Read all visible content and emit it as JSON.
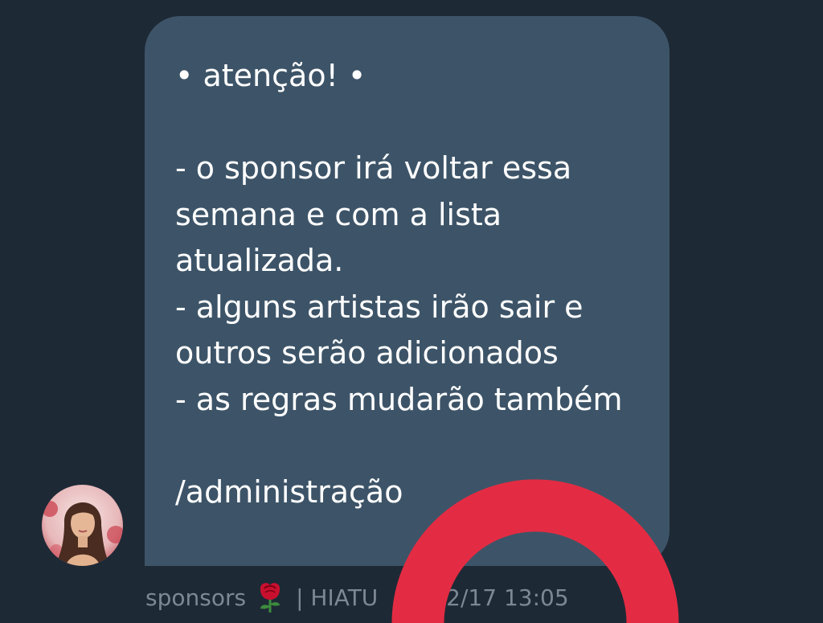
{
  "message": {
    "text": "• atenção! •\n\n- o sponsor irá voltar essa semana e com a lista atualizada.\n- alguns artistas irão sair e outros serão adicionados\n- as regras mudarão também\n\n/administração"
  },
  "meta": {
    "sender": "sponsors",
    "separator": "| HIATU",
    "timestamp": "02/12/17 13:05"
  },
  "icons": {
    "sender_emoji": "rose-icon",
    "overlay": "red-ring-overlay"
  },
  "colors": {
    "background": "#1e2936",
    "bubble": "#3d5468",
    "meta_text": "#7d8894",
    "ring": "#e32c43"
  }
}
